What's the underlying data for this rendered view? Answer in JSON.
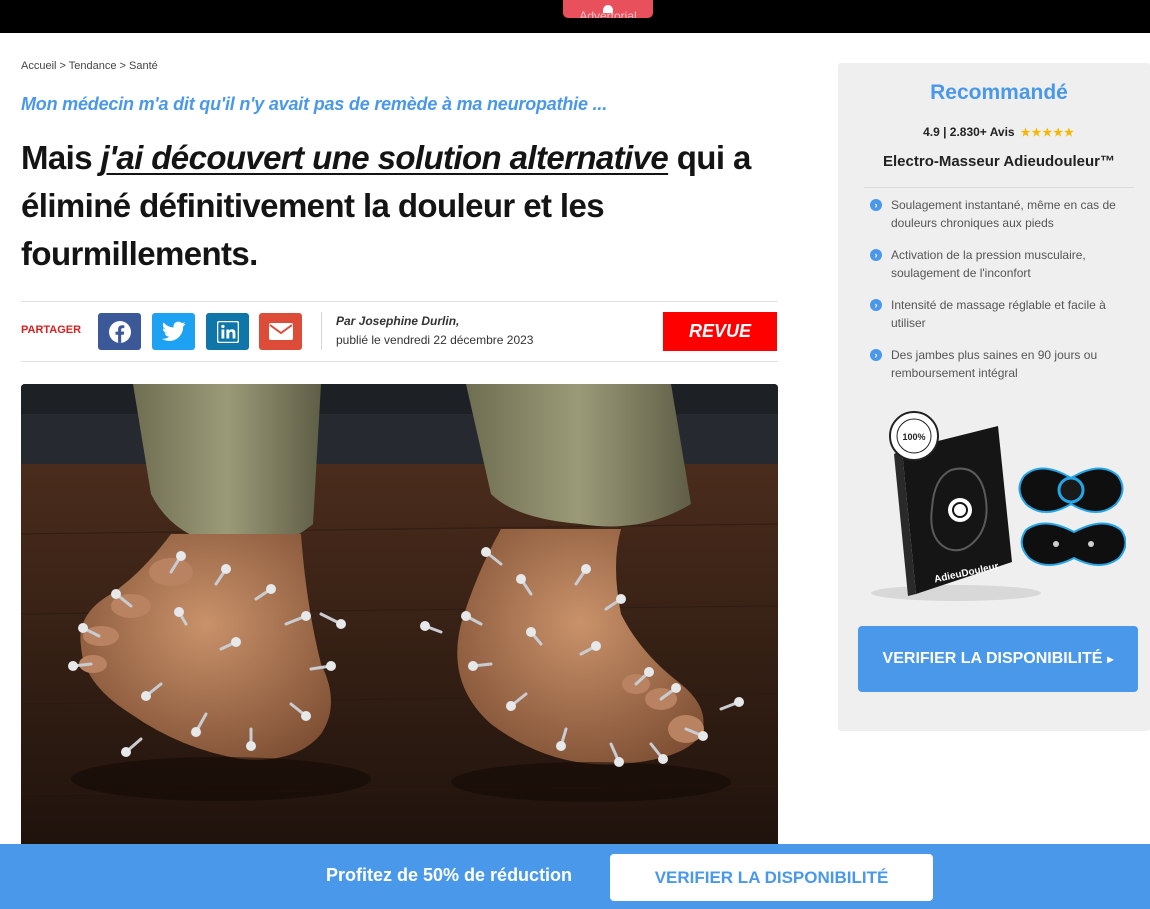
{
  "topbar": {
    "advertorial_label": "Advertorial"
  },
  "breadcrumb": "Accueil > Tendance > Santé",
  "article": {
    "kicker": "Mon médecin m'a dit qu'il n'y avait pas de remède à ma neuropathie ...",
    "headline_pre": "Mais ",
    "headline_emphasis": "j'ai découvert une solution alternative",
    "headline_post": " qui a éliminé définitivement la douleur et les fourmillements."
  },
  "share": {
    "label": "PARTAGER",
    "buttons": [
      {
        "icon": "facebook-icon",
        "color": "#3b5998"
      },
      {
        "icon": "twitter-icon",
        "color": "#1da1f2"
      },
      {
        "icon": "linkedin-icon",
        "color": "#0e76a8"
      },
      {
        "icon": "email-icon",
        "color": "#dd4b39"
      }
    ]
  },
  "author": {
    "byline": "Par Josephine Durlin,",
    "published": "publié le vendredi 22 décembre 2023"
  },
  "revue_badge": "REVUE",
  "sidebar": {
    "title": "Recommandé",
    "rating": "4.9 | 2.830+ Avis",
    "stars": "★★★★★",
    "product_name": "Electro-Masseur Adieudouleur™",
    "features": [
      "Soulagement instantané, même en cas de douleurs chroniques aux pieds",
      "Activation de la pression musculaire, soulagement de l'inconfort",
      "Intensité de massage réglable et facile à utiliser",
      "Des jambes plus saines en 90 jours ou remboursement intégral"
    ],
    "product_brand": "AdieuDouleur",
    "seal_text": "100%",
    "cta_label": "VERIFIER LA DISPONIBILITÉ",
    "cta_arrow": "▸"
  },
  "bottom_bar": {
    "promo": "Profitez de 50% de réduction",
    "cta_label": "VERIFIER LA DISPONIBILITÉ"
  },
  "colors": {
    "accent_blue": "#4a98ea",
    "revue_red": "#ff0000",
    "stars": "#f5b800"
  }
}
